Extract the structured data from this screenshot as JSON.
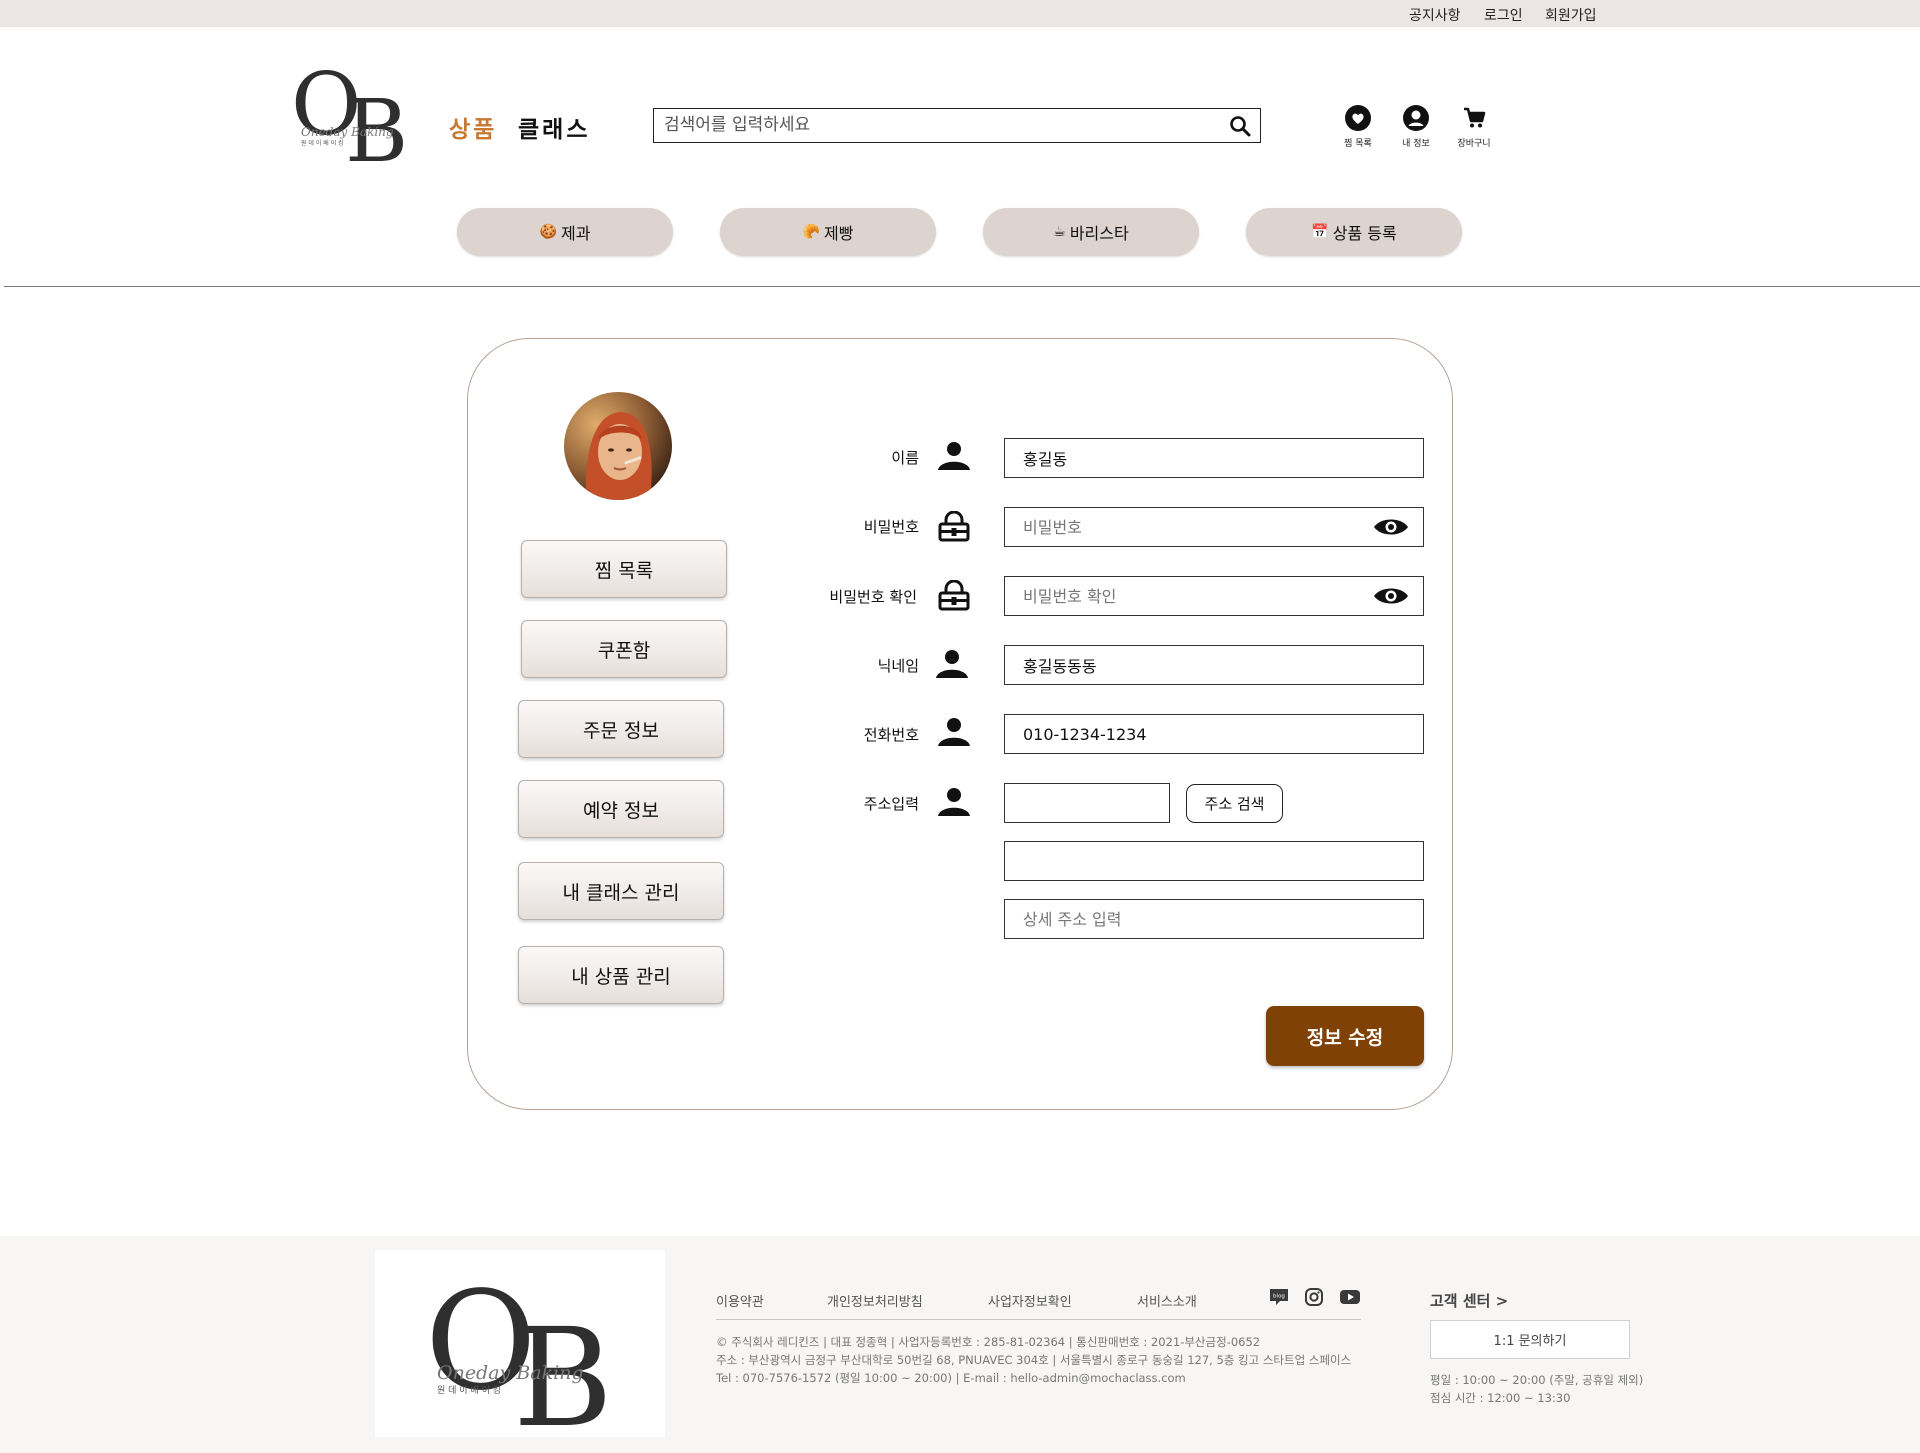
{
  "topbar": {
    "links": [
      "공지사항",
      "로그인",
      "회원가입"
    ]
  },
  "brand": {
    "logo_letters": "OB",
    "logo_script": "Oneday Baking",
    "logo_korean": "원 데 이   베 이 킹"
  },
  "nav": {
    "product": "상품",
    "class": "클래스",
    "product_color": "#c8782f"
  },
  "search": {
    "placeholder": "검색어를 입력하세요",
    "icon": "search-icon"
  },
  "header_icons": [
    {
      "label": "찜 목록",
      "icon": "heart-icon"
    },
    {
      "label": "내 정보",
      "icon": "user-circle-icon"
    },
    {
      "label": "장바구니",
      "icon": "cart-icon"
    }
  ],
  "categories": [
    {
      "emoji": "🍪",
      "label": "제과"
    },
    {
      "emoji": "🥐",
      "label": "제빵"
    },
    {
      "emoji": "☕",
      "label": "바리스타"
    },
    {
      "emoji": "📅",
      "label": "상품 등록"
    }
  ],
  "sidebar": {
    "buttons": [
      "찜 목록",
      "쿠폰함",
      "주문 정보",
      "예약 정보",
      "내 클래스 관리",
      "내 상품 관리"
    ]
  },
  "form": {
    "name": {
      "label": "이름",
      "value": "홍길동",
      "icon": "user-icon"
    },
    "password": {
      "label": "비밀번호",
      "placeholder": "비밀번호",
      "icon": "lock-icon",
      "toggle_icon": "eye-icon"
    },
    "password_confirm": {
      "label": "비밀번호 확인",
      "placeholder": "비밀번호 확인",
      "icon": "lock-icon",
      "toggle_icon": "eye-icon"
    },
    "nickname": {
      "label": "닉네임",
      "value": "홍길동동동",
      "icon": "user-icon"
    },
    "phone": {
      "label": "전화번호",
      "value": "010-1234-1234",
      "icon": "user-icon"
    },
    "address": {
      "label": "주소입력",
      "icon": "user-icon",
      "zipcode": "",
      "search_button": "주소 검색",
      "road": "",
      "detail_placeholder": "상세 주소 입력"
    },
    "submit": "정보 수정",
    "submit_color": "#7f4105"
  },
  "footer": {
    "links": [
      "이용약관",
      "개인정보처리방침",
      "사업자정보확인",
      "서비스소개"
    ],
    "social_icons": [
      "blog-icon",
      "instagram-icon",
      "youtube-icon"
    ],
    "blog_label": "blog",
    "info_lines": [
      "© 주식회사 레디킨즈 | 대표 정종혁 | 사업자등록번호 : 285-81-02364 | 통신판매번호 : 2021-부산금정-0652",
      "주소 : 부산광역시 금정구 부산대학로 50번길 68, PNUAVEC 304호 | 서울특별시 종로구 동숭길 127, 5층 킹고 스타트업 스페이스",
      "Tel : 070-7576-1572 (평일 10:00 ~ 20:00) | E-mail : hello-admin@mochaclass.com"
    ],
    "cs_title": "고객 센터 >",
    "cs_button": "1:1 문의하기",
    "cs_hours": [
      "평일 : 10:00 ~ 20:00 (주말, 공휴일 제외)",
      "점심 시간 : 12:00 ~ 13:30"
    ]
  }
}
